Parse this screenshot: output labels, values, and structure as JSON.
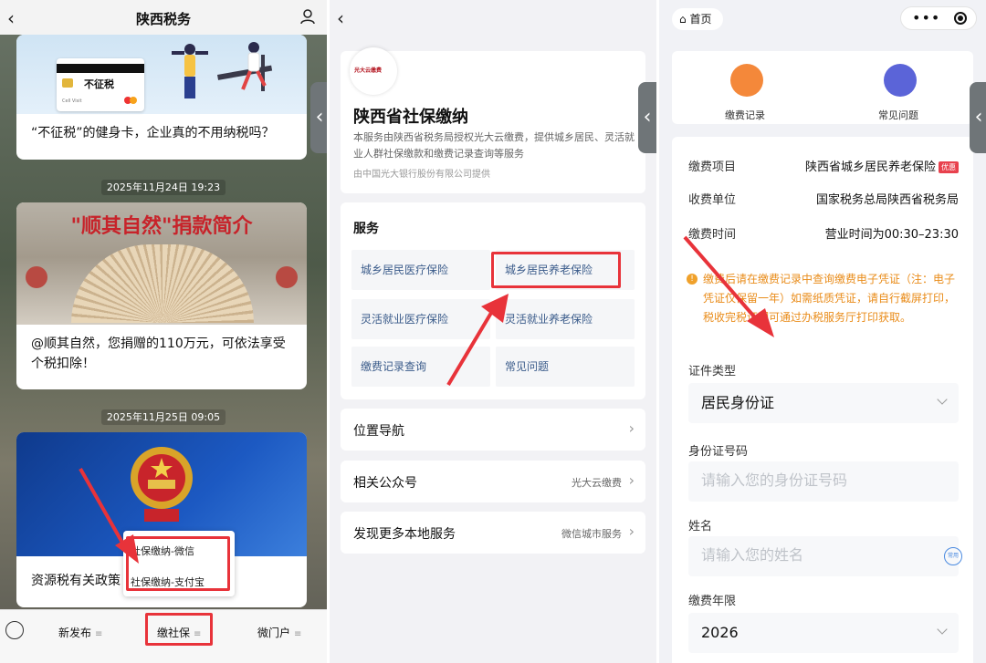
{
  "panel1": {
    "title": "陕西税务",
    "card1": {
      "img_text": "不征税",
      "card_chip": "Cell Visit",
      "text": "“不征税”的健身卡，企业真的不用纳税吗？"
    },
    "ts1": "2025年11月24日 19:23",
    "card2": {
      "img_text": "\"顺其自然\"捐款简介",
      "text": "@顺其自然，您捐赠的110万元，可依法享受个税扣除！"
    },
    "ts2": "2025年11月25日 09:05",
    "card3": {
      "text": "资源税有关政策"
    },
    "popup": {
      "item1": "社保缴纳-微信",
      "item2": "社保缴纳-支付宝"
    },
    "tabs": {
      "t1": "新发布",
      "t2": "缴社保",
      "t3": "微门户"
    }
  },
  "panel2": {
    "logo": "光大云缴费",
    "title": "陕西省社保缴纳",
    "desc": "本服务由陕西省税务局授权光大云缴费，提供城乡居民、灵活就业人群社保缴款和缴费记录查询等服务",
    "by": "由中国光大银行股份有限公司提供",
    "services_title": "服务",
    "services": [
      "城乡居民医疗保险",
      "城乡居民养老保险",
      "灵活就业医疗保险",
      "灵活就业养老保险",
      "缴费记录查询",
      "常见问题"
    ],
    "rows": [
      {
        "label": "位置导航",
        "right": ""
      },
      {
        "label": "相关公众号",
        "right": "光大云缴费"
      },
      {
        "label": "发现更多本地服务",
        "right": "微信城市服务"
      }
    ]
  },
  "panel3": {
    "home": "首页",
    "icon1": "缴费记录",
    "icon2": "常见问题",
    "item_label": "缴费项目",
    "item_value": "陕西省城乡居民养老保险",
    "item_tag": "优惠",
    "unit_label": "收费单位",
    "unit_value": "国家税务总局陕西省税务局",
    "time_label": "缴费时间",
    "time_value": "营业时间为00:30–23:30",
    "note": "缴费后请在缴费记录中查询缴费电子凭证（注：电子凭证仅保留一年）如需纸质凭证，请自行截屏打印，税收完税证明可通过办税服务厅打印获取。",
    "id_type_label": "证件类型",
    "id_type_value": "居民身份证",
    "id_no_label": "身份证号码",
    "id_no_placeholder": "请输入您的身份证号码",
    "name_label": "姓名",
    "name_placeholder": "请输入您的姓名",
    "name_common": "常用",
    "year_label": "缴费年限",
    "year_value": "2026"
  },
  "colors": {
    "highlight": "#e8333a",
    "link": "#3a5b8a",
    "warning": "#e98c1a"
  }
}
